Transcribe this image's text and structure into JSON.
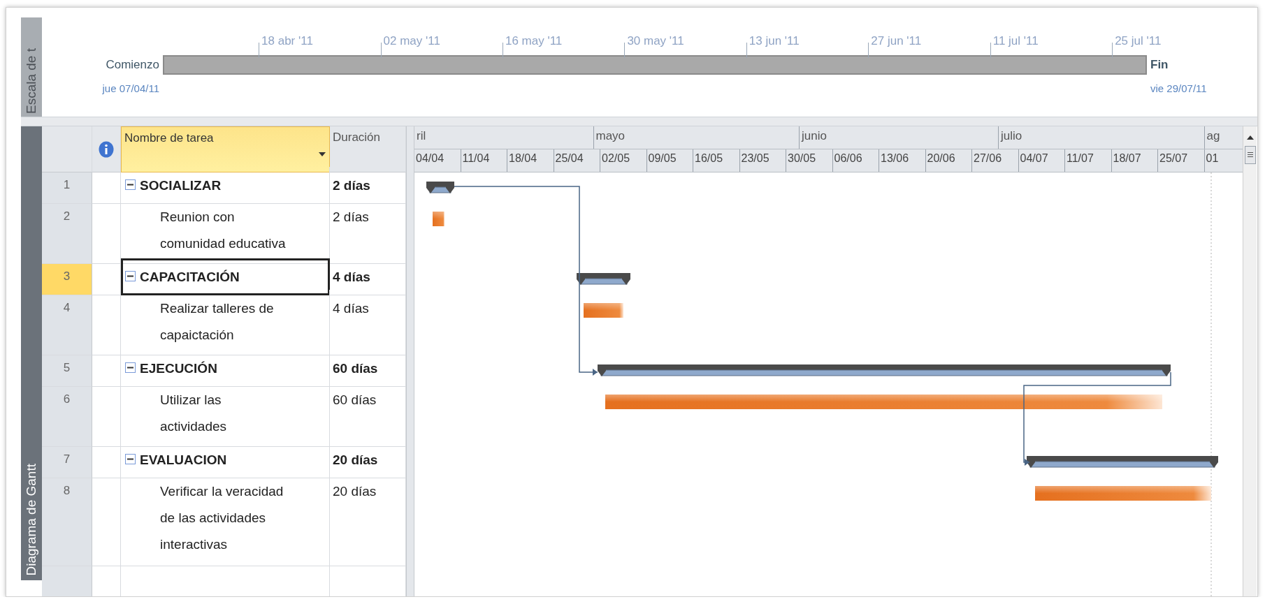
{
  "timescale": {
    "side_label": "Escala de t",
    "start_label": "Comienzo",
    "start_date": "jue 07/04/11",
    "finish_label": "Fin",
    "finish_date": "vie 29/07/11",
    "ticks": [
      "18 abr '11",
      "02 may '11",
      "16 may '11",
      "30 may '11",
      "13 jun '11",
      "27 jun '11",
      "11 jul '11",
      "25 jul '11"
    ]
  },
  "view": {
    "side_label": "Diagrama de Gantt"
  },
  "table": {
    "columns": [
      "Nombre de tarea",
      "Duración"
    ],
    "rows": [
      {
        "id": "1",
        "name": "SOCIALIZAR",
        "duration": "2 días",
        "kind": "summary",
        "expanded": true,
        "selected": false
      },
      {
        "id": "2",
        "name": "Reunion con comunidad educativa",
        "duration": "2 días",
        "kind": "task",
        "selected": false
      },
      {
        "id": "3",
        "name": "CAPACITACIÓN",
        "duration": "4 días",
        "kind": "summary",
        "expanded": true,
        "selected": true
      },
      {
        "id": "4",
        "name": "Realizar talleres de capaictación",
        "duration": "4 días",
        "kind": "task",
        "selected": false
      },
      {
        "id": "5",
        "name": "EJECUCIÓN",
        "duration": "60 días",
        "kind": "summary",
        "expanded": true,
        "selected": false
      },
      {
        "id": "6",
        "name": "Utilizar las actividades",
        "duration": "60 días",
        "kind": "task",
        "selected": false
      },
      {
        "id": "7",
        "name": "EVALUACION",
        "duration": "20 días",
        "kind": "summary",
        "expanded": true,
        "selected": false
      },
      {
        "id": "8",
        "name": "Verificar la veracidad de las actividades interactivas",
        "duration": "20 días",
        "kind": "task",
        "selected": false
      }
    ]
  },
  "chart": {
    "months": [
      "ril",
      "mayo",
      "junio",
      "julio",
      "ag"
    ],
    "weeks": [
      "04/04",
      "11/04",
      "18/04",
      "25/04",
      "02/05",
      "09/05",
      "16/05",
      "23/05",
      "30/05",
      "06/06",
      "13/06",
      "20/06",
      "27/06",
      "04/07",
      "11/07",
      "18/07",
      "25/07",
      "01"
    ]
  }
}
